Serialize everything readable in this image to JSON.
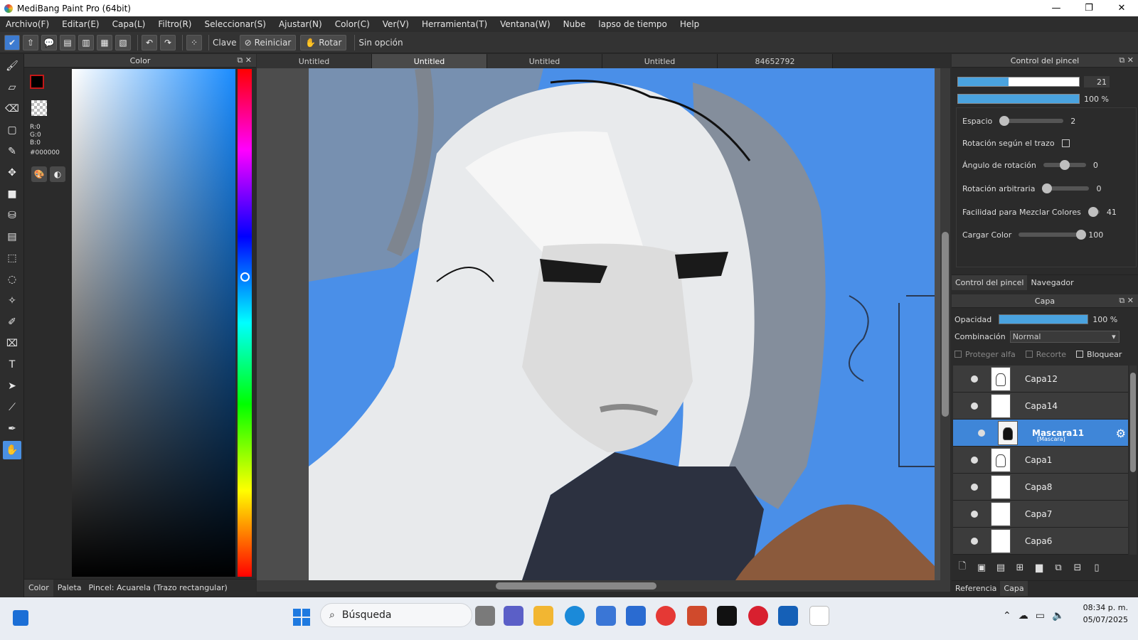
{
  "window": {
    "title": "MediBang Paint Pro (64bit)",
    "minimize_glyph": "—",
    "maximize_glyph": "❐",
    "close_glyph": "✕"
  },
  "menu": [
    "Archivo(F)",
    "Editar(E)",
    "Capa(L)",
    "Filtro(R)",
    "Seleccionar(S)",
    "Ajustar(N)",
    "Color(C)",
    "Ver(V)",
    "Herramienta(T)",
    "Ventana(W)",
    "Nube",
    "lapso de tiempo",
    "Help"
  ],
  "toolbar": {
    "clave_label": "Clave",
    "reiniciar_label": "Reiniciar",
    "rotar_label": "Rotar",
    "sin_opcion_label": "Sin opción"
  },
  "color_panel": {
    "title": "Color",
    "r": "R:0",
    "g": "G:0",
    "b": "B:0",
    "hex": "#000000",
    "fg_color": "#000000",
    "tabs": [
      "Color",
      "Paleta"
    ],
    "status": "Pincel: Acuarela (Trazo rectangular)"
  },
  "doc_tabs": [
    "Untitled",
    "Untitled",
    "Untitled",
    "Untitled",
    "84652792"
  ],
  "brush_panel": {
    "title": "Control del pincel",
    "size_value": "21",
    "size_fraction": 0.42,
    "opacity_value": "100 %",
    "opacity_fraction": 1.0,
    "settings": [
      {
        "label": "Espacio",
        "value": "2",
        "level": 0.04
      },
      {
        "label": "Rotación según el trazo",
        "checkbox": true
      },
      {
        "label": "Ángulo de rotación",
        "value": "0",
        "level": 0.5
      },
      {
        "label": "Rotación arbitraria",
        "value": "0",
        "level": 0.0
      },
      {
        "label": "Facilidad para Mezclar Colores",
        "value": "41",
        "level": 0.41
      },
      {
        "label": "Cargar Color",
        "value": "100",
        "level": 1.0
      }
    ],
    "tabs": [
      "Control del pincel",
      "Navegador"
    ]
  },
  "layer_panel": {
    "title": "Capa",
    "opacity_label": "Opacidad",
    "opacity_value": "100 %",
    "blend_label": "Combinación",
    "blend_value": "Normal",
    "protect_alpha": "Proteger alfa",
    "clip": "Recorte",
    "lock": "Bloquear",
    "layers": [
      {
        "name": "Capa12"
      },
      {
        "name": "Capa14"
      },
      {
        "name": "Mascara11",
        "sub": "[Mascara]",
        "selected": true
      },
      {
        "name": "Capa1"
      },
      {
        "name": "Capa8"
      },
      {
        "name": "Capa7"
      },
      {
        "name": "Capa6"
      }
    ],
    "tabs": [
      "Referencia",
      "Capa"
    ]
  },
  "taskbar": {
    "search_placeholder": "Búsqueda",
    "time": "08:34 p. m.",
    "date": "05/07/2025"
  }
}
